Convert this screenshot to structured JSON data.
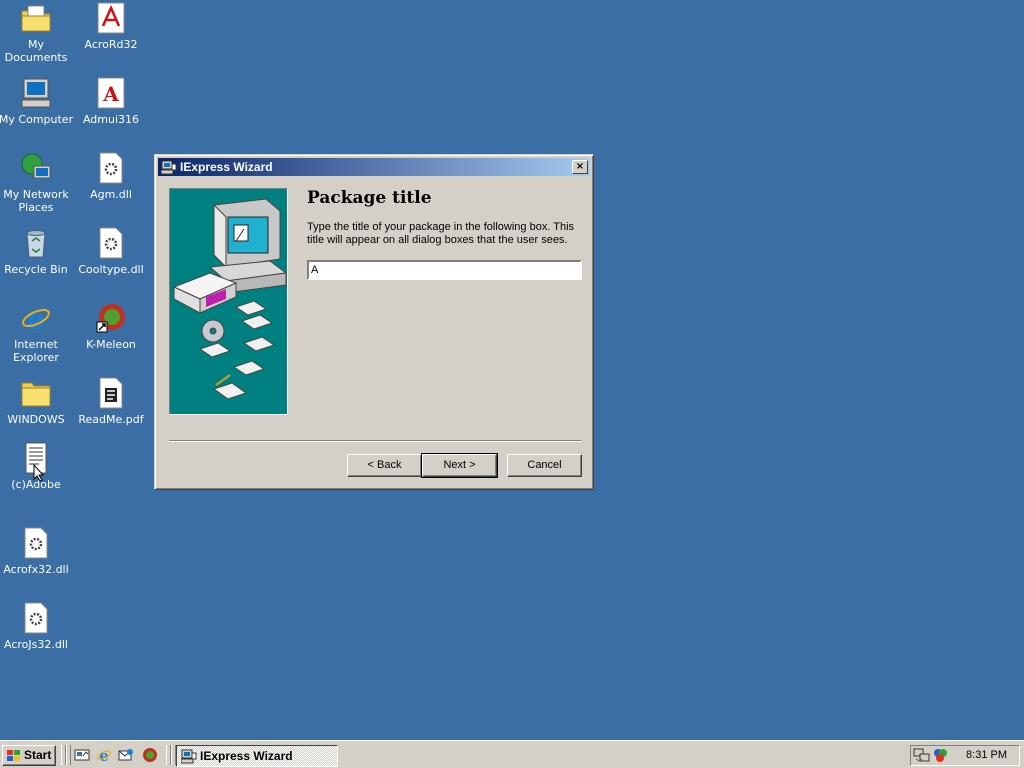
{
  "desktop": {
    "icons": [
      {
        "label": "My Documents",
        "icon": "folder-documents-icon"
      },
      {
        "label": "AcroRd32",
        "icon": "acrobat-reader-icon"
      },
      {
        "label": "My Computer",
        "icon": "computer-icon"
      },
      {
        "label": "Admui316",
        "icon": "adobe-a-icon"
      },
      {
        "label": "My Network Places",
        "icon": "network-icon"
      },
      {
        "label": "Agm.dll",
        "icon": "dll-file-icon"
      },
      {
        "label": "Recycle Bin",
        "icon": "recycle-bin-icon"
      },
      {
        "label": "Cooltype.dll",
        "icon": "dll-file-icon"
      },
      {
        "label": "Internet Explorer",
        "icon": "internet-explorer-icon"
      },
      {
        "label": "K-Meleon",
        "icon": "k-meleon-icon"
      },
      {
        "label": "WINDOWS",
        "icon": "folder-icon"
      },
      {
        "label": "ReadMe.pdf",
        "icon": "pdf-file-icon"
      },
      {
        "label": "(c)Adobe",
        "icon": "text-document-icon"
      },
      {
        "label": "Acrofx32.dll",
        "icon": "dll-file-icon"
      },
      {
        "label": "AcroJs32.dll",
        "icon": "dll-file-icon"
      }
    ]
  },
  "dialog": {
    "title": "IExpress Wizard",
    "close_label": "×",
    "heading": "Package title",
    "description": "Type the title of your package in the following  box.  This title will appear on all dialog boxes that the user sees.",
    "input_value": "A",
    "buttons": {
      "back": "< Back",
      "next": "Next >",
      "cancel": "Cancel"
    }
  },
  "taskbar": {
    "start_label": "Start",
    "task_label": "IExpress Wizard",
    "clock": "8:31 PM"
  },
  "colors": {
    "desktop": "#3a6ea5",
    "wizard_art": "#008080",
    "titlebar_start": "#0a246a",
    "titlebar_end": "#a6caf0"
  }
}
